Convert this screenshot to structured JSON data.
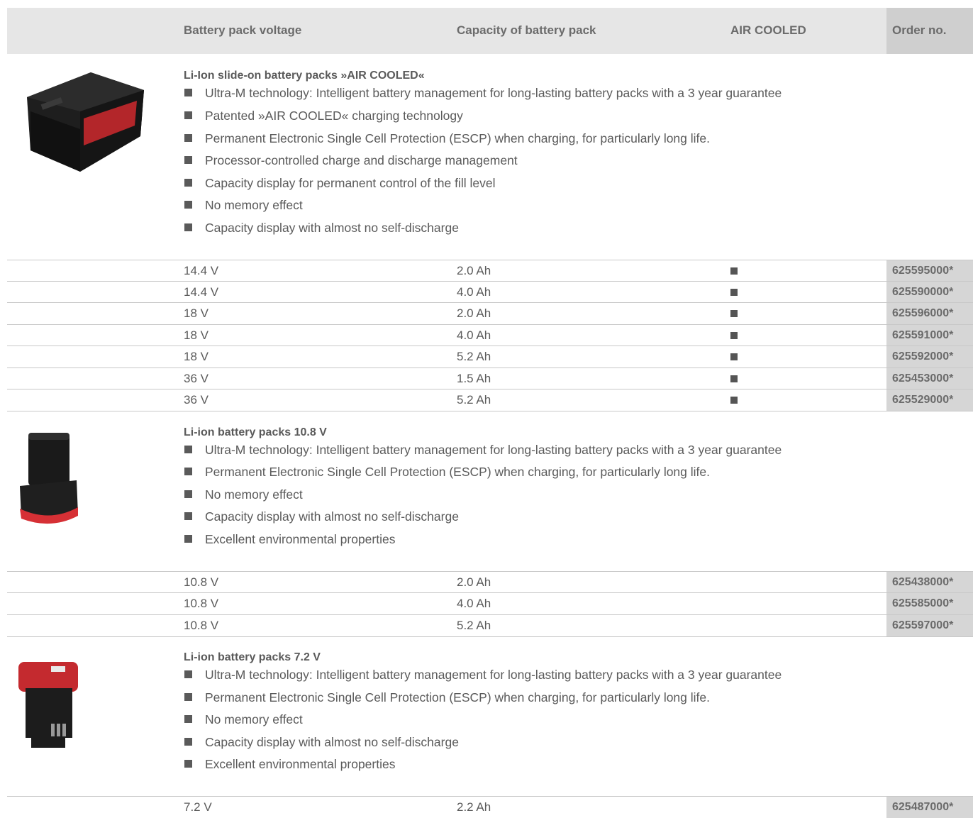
{
  "header": {
    "voltage": "Battery pack voltage",
    "capacity": "Capacity of battery pack",
    "air_cooled": "AIR COOLED",
    "order": "Order no."
  },
  "sections": [
    {
      "title": "Li-Ion slide-on battery packs »AIR COOLED«",
      "features": [
        "Ultra-M technology: Intelligent battery management for long-lasting battery packs with a 3 year guarantee",
        "Patented »AIR COOLED« charging technology",
        "Permanent Electronic Single Cell Protection (ESCP) when charging, for particularly long life.",
        "Processor-controlled charge and discharge management",
        "Capacity display for permanent control of the fill level",
        "No memory effect",
        "Capacity display with almost no self-discharge"
      ],
      "rows": [
        {
          "voltage": "14.4 V",
          "capacity": "2.0 Ah",
          "air": true,
          "order": "625595000*"
        },
        {
          "voltage": "14.4 V",
          "capacity": "4.0 Ah",
          "air": true,
          "order": "625590000*"
        },
        {
          "voltage": "18 V",
          "capacity": "2.0 Ah",
          "air": true,
          "order": "625596000*"
        },
        {
          "voltage": "18 V",
          "capacity": "4.0 Ah",
          "air": true,
          "order": "625591000*"
        },
        {
          "voltage": "18 V",
          "capacity": "5.2 Ah",
          "air": true,
          "order": "625592000*"
        },
        {
          "voltage": "36 V",
          "capacity": "1.5 Ah",
          "air": true,
          "order": "625453000*"
        },
        {
          "voltage": "36 V",
          "capacity": "5.2 Ah",
          "air": true,
          "order": "625529000*"
        }
      ]
    },
    {
      "title": "Li-ion battery packs 10.8 V",
      "features": [
        "Ultra-M technology: Intelligent battery management for long-lasting battery packs with a 3 year guarantee",
        "Permanent Electronic Single Cell Protection (ESCP) when charging, for particularly long life.",
        "No memory effect",
        "Capacity display with almost no self-discharge",
        "Excellent environmental properties"
      ],
      "rows": [
        {
          "voltage": "10.8 V",
          "capacity": "2.0 Ah",
          "air": false,
          "order": "625438000*"
        },
        {
          "voltage": "10.8 V",
          "capacity": "4.0 Ah",
          "air": false,
          "order": "625585000*"
        },
        {
          "voltage": "10.8 V",
          "capacity": "5.2 Ah",
          "air": false,
          "order": "625597000*"
        }
      ]
    },
    {
      "title": "Li-ion battery packs 7.2 V",
      "features": [
        "Ultra-M technology: Intelligent battery management for long-lasting battery packs with a 3 year guarantee",
        "Permanent Electronic Single Cell Protection (ESCP) when charging, for particularly long life.",
        "No memory effect",
        "Capacity display with almost no self-discharge",
        "Excellent environmental properties"
      ],
      "rows": [
        {
          "voltage": "7.2 V",
          "capacity": "2.2 Ah",
          "air": false,
          "order": "625487000*"
        }
      ]
    }
  ]
}
